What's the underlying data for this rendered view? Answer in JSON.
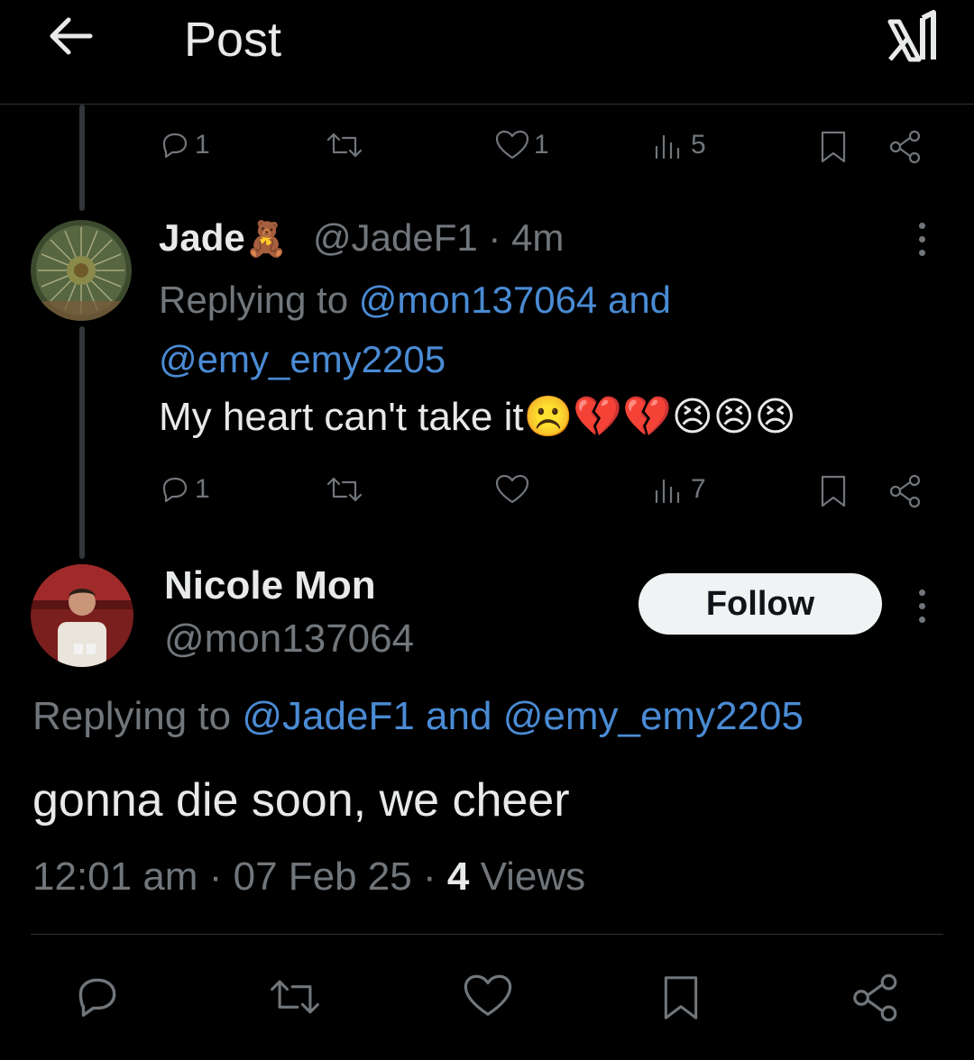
{
  "header": {
    "title": "Post",
    "back_icon": "arrow-left-icon",
    "logo_icon": "x-logo-icon"
  },
  "prev_tweet_actions": {
    "replies": "1",
    "reposts": "",
    "likes": "1",
    "views": "5"
  },
  "reply_tweet": {
    "name": "Jade",
    "name_emoji": "🧸",
    "handle": "@JadeF1",
    "time": "4m",
    "replying_prefix": "Replying to",
    "replying_user1": "@mon137064",
    "replying_and": "and",
    "replying_user2": "@emy_emy2205",
    "text": "My heart can't take it",
    "text_emojis": "☹️💔💔😣😣😣",
    "actions": {
      "replies": "1",
      "reposts": "",
      "likes": "",
      "views": "7"
    }
  },
  "main_tweet": {
    "name": "Nicole Mon",
    "handle": "@mon137064",
    "follow_label": "Follow",
    "replying_prefix": "Replying to",
    "replying_user1": "@JadeF1",
    "replying_and": "and",
    "replying_user2": "@emy_emy2205",
    "text": "gonna die soon, we cheer",
    "time": "12:01 am",
    "date": "07 Feb 25",
    "views_count": "4",
    "views_label": "Views"
  },
  "colors": {
    "background": "#000000",
    "link": "#4a8bd4",
    "muted": "#71767b",
    "text": "#e7e9ea",
    "follow_bg": "#eff3f4"
  }
}
